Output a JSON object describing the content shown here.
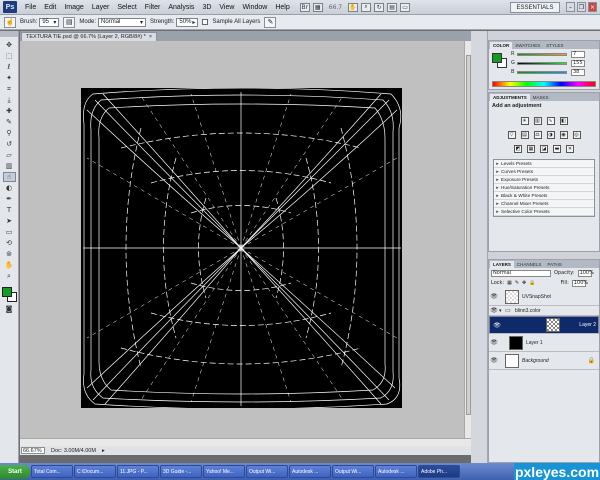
{
  "menubar": {
    "logo": "Ps",
    "items": [
      "File",
      "Edit",
      "Image",
      "Layer",
      "Select",
      "Filter",
      "Analysis",
      "3D",
      "View",
      "Window",
      "Help"
    ],
    "zoom": "66.7",
    "workspace": "ESSENTIALS"
  },
  "options": {
    "brush_label": "Brush:",
    "brush_size": "95",
    "mode_label": "Mode:",
    "mode_value": "Normal",
    "strength_label": "Strength:",
    "strength_value": "50%",
    "sample_all_layers": "Sample All Layers"
  },
  "document": {
    "tab_title": "TEXTURA TIE.psd @ 66.7% (Layer 2, RGB/8#) *",
    "status_zoom": "66.67%",
    "status_doc": "Doc: 3.00M/4.00M"
  },
  "colors": {
    "foreground": "#129c26",
    "background": "#ffffff",
    "selected_layer": "#0e2a6b"
  },
  "color_panel": {
    "tabs": [
      "COLOR",
      "SWATCHES",
      "STYLES"
    ],
    "r_label": "R",
    "r_value": "7",
    "g_label": "G",
    "g_value": "155",
    "b_label": "B",
    "b_value": "38"
  },
  "adjustments_panel": {
    "tabs": [
      "ADJUSTMENTS",
      "MASKS"
    ],
    "title": "Add an adjustment",
    "presets": [
      "Levels Presets",
      "Curves Presets",
      "Exposure Presets",
      "Hue/Saturation Presets",
      "Black & White Presets",
      "Channel Mixer Presets",
      "Selective Color Presets"
    ]
  },
  "layers_panel": {
    "tabs": [
      "LAYERS",
      "CHANNELS",
      "PATHS"
    ],
    "blend_mode": "Normal",
    "opacity_label": "Opacity:",
    "opacity_value": "100%",
    "lock_label": "Lock:",
    "fill_label": "Fill:",
    "fill_value": "100%",
    "layers": [
      {
        "name": "UVSnapShot",
        "thumb": "checker"
      },
      {
        "name": "blinn3.color",
        "thumb": "group"
      },
      {
        "name": "Layer 2",
        "thumb": "checker-dark",
        "selected": true
      },
      {
        "name": "Layer 1",
        "thumb": "black"
      },
      {
        "name": "Background",
        "thumb": "white",
        "locked": true
      }
    ]
  },
  "taskbar": {
    "start": "Start",
    "tasks": [
      "Total Com...",
      "C:\\Docum...",
      "11.JPG - P...",
      "3D Guide -...",
      "Yahoo! Me...",
      "Output Wi...",
      "Autodesk ...",
      "Output Wi...",
      "Autodesk ...",
      "Adobe Ph..."
    ],
    "watermark": "pxleyes.com"
  }
}
